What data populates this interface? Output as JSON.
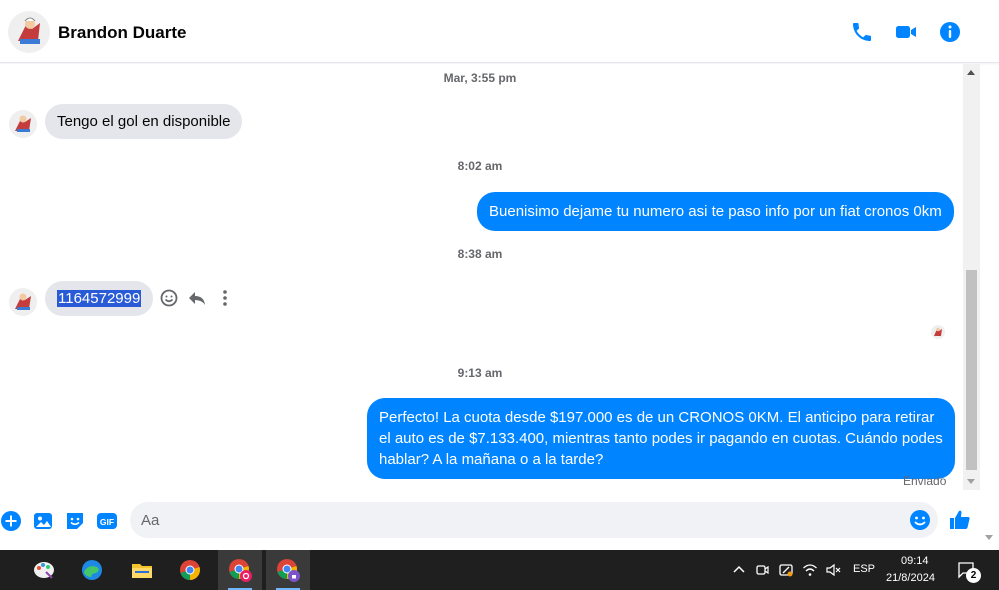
{
  "header": {
    "contact_name": "Brandon Duarte",
    "icons": [
      "phone-icon",
      "video-camera-icon",
      "info-icon"
    ],
    "accent_color": "#0084ff"
  },
  "chat": {
    "timestamps": [
      "Mar, 3:55 pm",
      "8:02 am",
      "8:38 am",
      "9:13 am"
    ],
    "msg1": "Tengo el gol en disponible",
    "msg2": "Buenisimo dejame tu numero asi te paso info por un fiat cronos 0km",
    "msg3": "1164572999",
    "msg4": "Perfecto! La cuota desde $197.000 es de un CRONOS 0KM. El anticipo para retirar el auto es de $7.133.400, mientras tanto podes ir pagando en cuotas. Cuándo podes hablar? A la mañana o a la tarde?",
    "status": "Enviado",
    "message_actions": [
      "emoji-react-icon",
      "reply-icon",
      "more-options-icon"
    ]
  },
  "composer": {
    "placeholder": "Aa",
    "value": "",
    "icons": [
      "add-icon",
      "photo-icon",
      "sticker-icon",
      "gif-icon",
      "emoji-icon",
      "like-icon"
    ]
  },
  "taskbar": {
    "apps": [
      "paint-app",
      "edge-app",
      "file-explorer-app",
      "chrome-app",
      "chrome-profile-app",
      "chrome-profile-2-app"
    ],
    "language": "ESP",
    "time": "09:14",
    "date": "21/8/2024",
    "notification_count": "2"
  }
}
